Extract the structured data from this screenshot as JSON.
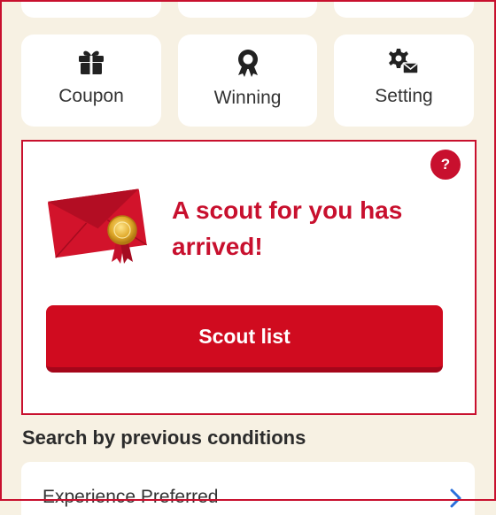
{
  "menu": {
    "tiles": [
      {
        "label": "Coupon",
        "icon": "gift-icon"
      },
      {
        "label": "Winning",
        "icon": "award-ribbon-icon"
      },
      {
        "label": "Setting",
        "icon": "settings-mail-icon"
      }
    ]
  },
  "scout": {
    "help_label": "?",
    "message": "A scout for you has arrived!",
    "button_label": "Scout list",
    "envelope_icon": "red-envelope-seal-icon"
  },
  "previous_conditions": {
    "title": "Search by previous conditions",
    "items": [
      {
        "label": "Experience Preferred",
        "icon": "chevron-right-icon"
      }
    ]
  },
  "colors": {
    "accent": "#c8102e",
    "button": "#d00b1f",
    "background": "#f7f1e3",
    "chevron": "#2a6fdb"
  }
}
